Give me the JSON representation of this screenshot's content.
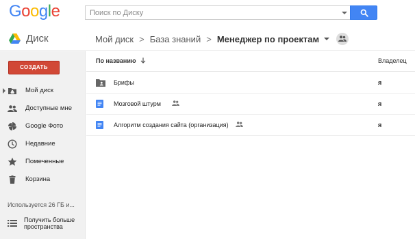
{
  "header": {
    "logo": [
      "G",
      "o",
      "o",
      "g",
      "l",
      "e"
    ],
    "logo_colors": [
      "#4285f4",
      "#ea4335",
      "#fbbc05",
      "#4285f4",
      "#34a853",
      "#ea4335"
    ],
    "search_placeholder": "Поиск по Диску"
  },
  "drivebar": {
    "app_title": "Диск",
    "breadcrumbs": [
      "Мой диск",
      "База знаний"
    ],
    "current": "Менеджер по проектам",
    "separator": ">"
  },
  "sidebar": {
    "create_label": "СОЗДАТЬ",
    "items": [
      {
        "label": "Мой диск",
        "icon": "drive-folder-icon"
      },
      {
        "label": "Доступные мне",
        "icon": "people-icon"
      },
      {
        "label": "Google Фото",
        "icon": "pinwheel-icon"
      },
      {
        "label": "Недавние",
        "icon": "clock-icon"
      },
      {
        "label": "Помеченные",
        "icon": "star-icon"
      },
      {
        "label": "Корзина",
        "icon": "trash-icon"
      }
    ],
    "storage_text": "Используется 26 ГБ и...",
    "more_storage": "Получить больше пространства",
    "more_storage_lines": [
      "Получить больше",
      "пространства"
    ]
  },
  "list": {
    "sort_label": "По названию",
    "owner_header": "Владелец",
    "rows": [
      {
        "name": "Брифы",
        "owner": "я",
        "type": "shared-folder",
        "shared": false
      },
      {
        "name": "Мозговой штурм",
        "owner": "я",
        "type": "doc",
        "shared": true
      },
      {
        "name": "Алгоритм создания сайта (организация)",
        "owner": "я",
        "type": "doc",
        "shared": true
      }
    ]
  },
  "colors": {
    "accent_blue": "#4285f4",
    "create_red": "#d14836",
    "sidebar_bg": "#f1f1f1"
  }
}
